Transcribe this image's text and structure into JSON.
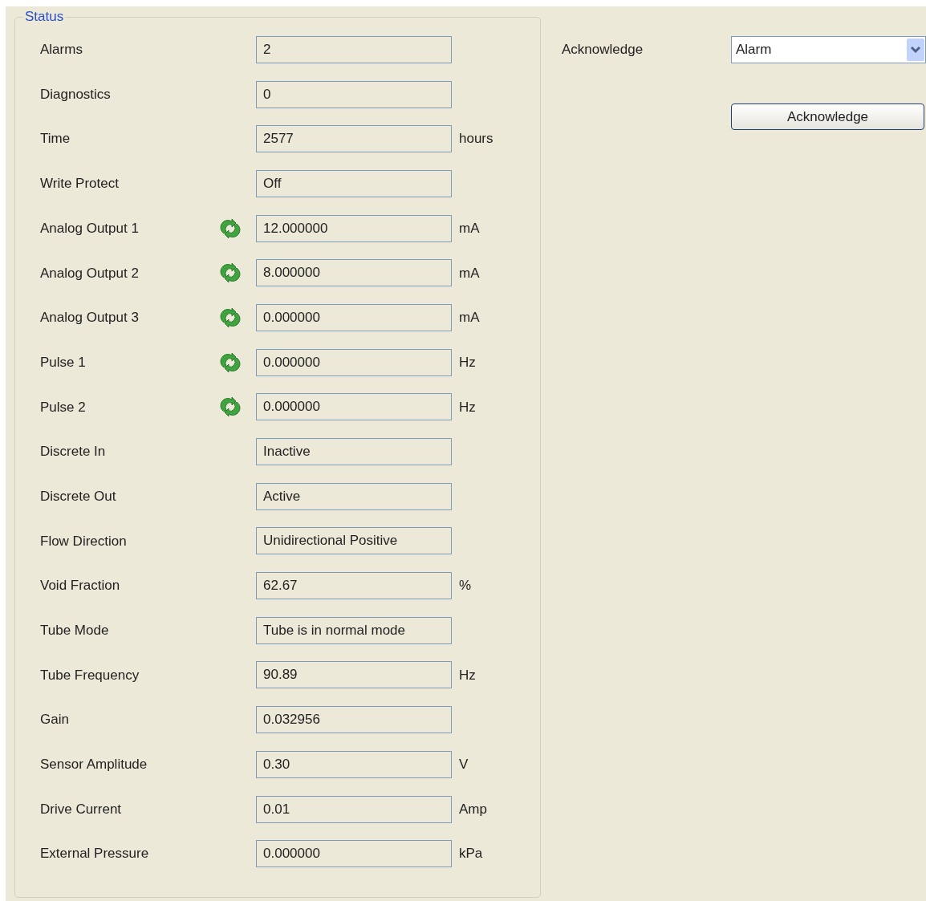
{
  "group": {
    "title": "Status"
  },
  "rows": [
    {
      "label": "Alarms",
      "value": "2",
      "refresh_button": false
    },
    {
      "label": "Diagnostics",
      "value": "0",
      "refresh_button": false
    },
    {
      "label": "Time",
      "value": "2577",
      "unit": "hours",
      "refresh_button": false
    },
    {
      "label": "Write Protect",
      "value": "Off",
      "refresh_button": false
    },
    {
      "label": "Analog Output 1",
      "value": "12.000000",
      "unit": "mA",
      "refresh_button": true
    },
    {
      "label": "Analog Output 2",
      "value": "8.000000",
      "unit": "mA",
      "refresh_button": true
    },
    {
      "label": "Analog Output 3",
      "value": "0.000000",
      "unit": "mA",
      "refresh_button": true
    },
    {
      "label": "Pulse 1",
      "value": "0.000000",
      "unit": "Hz",
      "refresh_button": true
    },
    {
      "label": "Pulse 2",
      "value": "0.000000",
      "unit": "Hz",
      "refresh_button": true
    },
    {
      "label": "Discrete In",
      "value": "Inactive",
      "refresh_button": false
    },
    {
      "label": "Discrete Out",
      "value": "Active",
      "refresh_button": false
    },
    {
      "label": "Flow Direction",
      "value": "Unidirectional Positive",
      "refresh_button": false
    },
    {
      "label": "Void Fraction",
      "value": "62.67",
      "unit": "%",
      "refresh_button": false
    },
    {
      "label": "Tube Mode",
      "value": "Tube is in normal mode",
      "refresh_button": false
    },
    {
      "label": "Tube Frequency",
      "value": "90.89",
      "unit": "Hz",
      "refresh_button": false
    },
    {
      "label": "Gain",
      "value": "0.032956",
      "refresh_button": false
    },
    {
      "label": "Sensor Amplitude",
      "value": "0.30",
      "unit": "V",
      "refresh_button": false
    },
    {
      "label": "Drive Current",
      "value": "0.01",
      "unit": "Amp",
      "refresh_button": false
    },
    {
      "label": "External Pressure",
      "value": "0.000000",
      "unit": "kPa",
      "refresh_button": false
    }
  ],
  "acknowledge": {
    "label": "Acknowledge",
    "dropdown_value": "Alarm",
    "button": "Acknowledge"
  }
}
